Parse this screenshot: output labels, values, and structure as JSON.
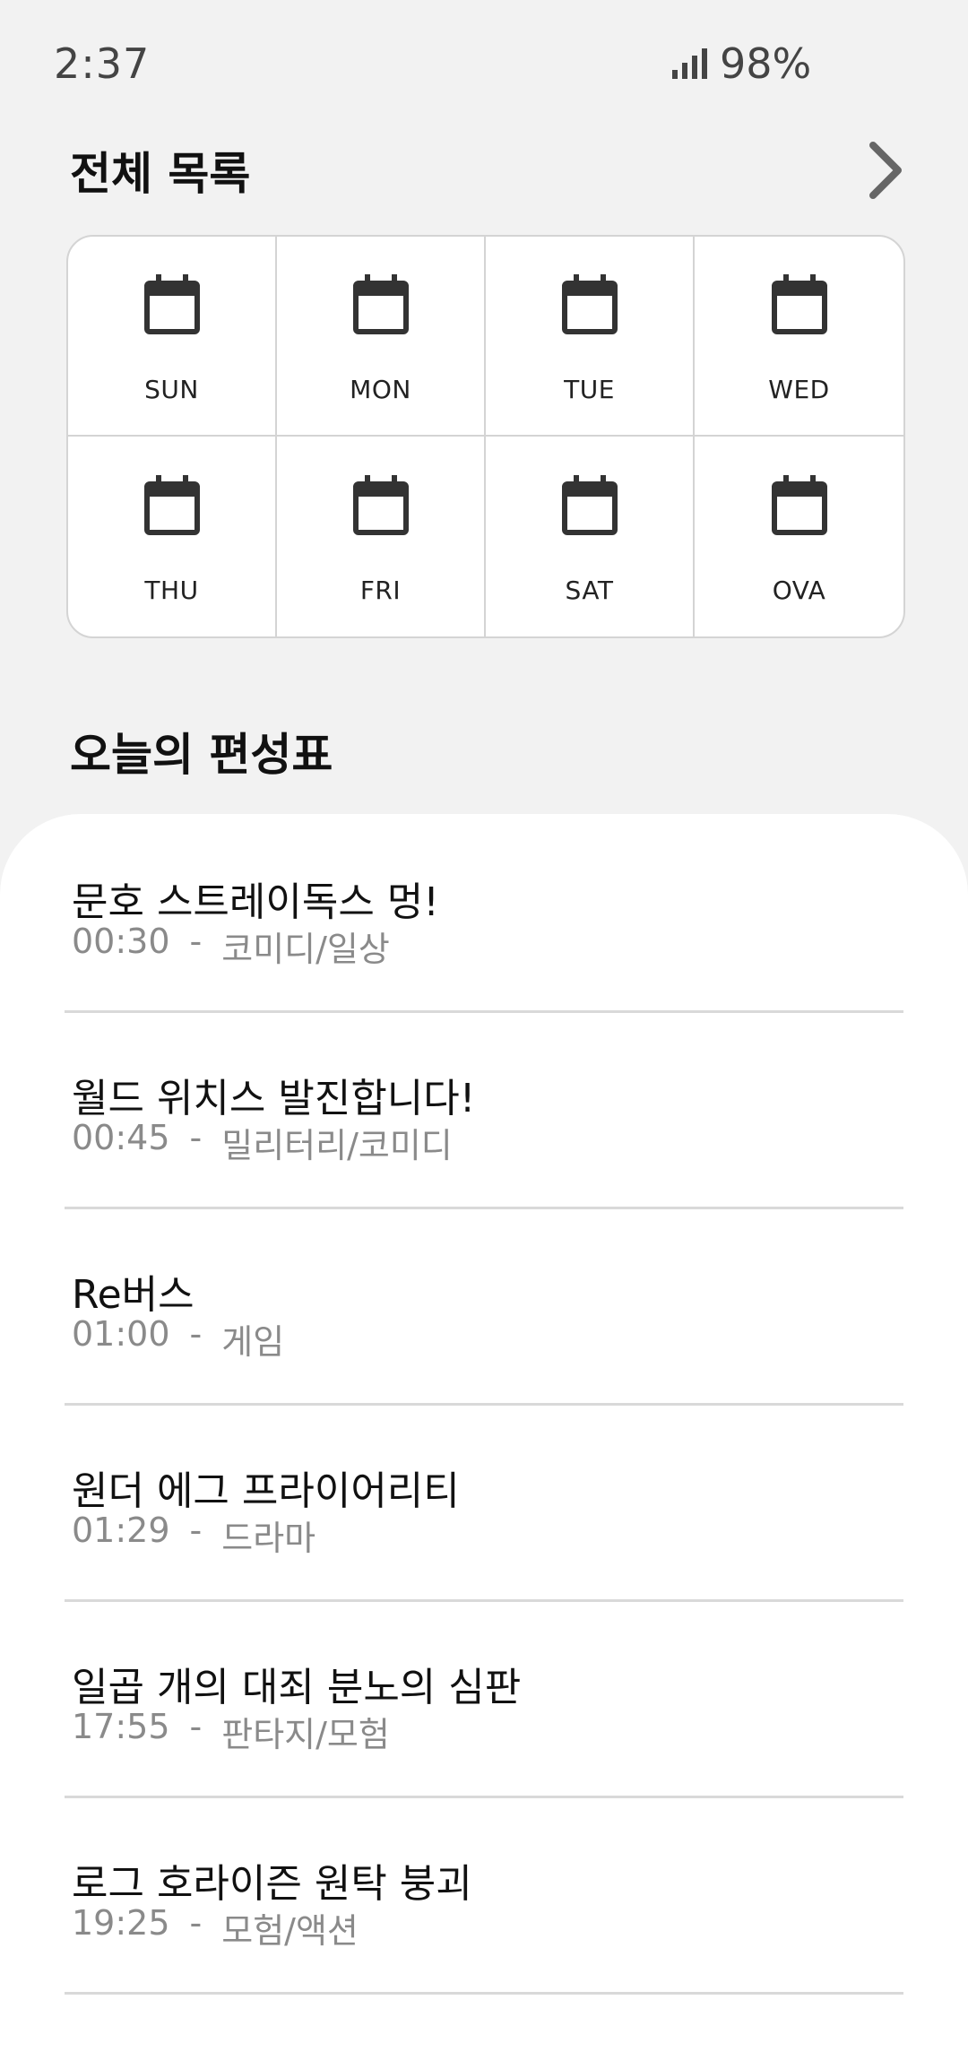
{
  "status_bar": {
    "time": "2:37",
    "battery": "98%",
    "signal_icon": "signal-icon"
  },
  "full_list": {
    "title": "전체 목록",
    "more_icon": "chevron-right-icon"
  },
  "days": [
    {
      "label": "SUN",
      "icon": "calendar-icon"
    },
    {
      "label": "MON",
      "icon": "calendar-icon"
    },
    {
      "label": "TUE",
      "icon": "calendar-icon"
    },
    {
      "label": "WED",
      "icon": "calendar-icon"
    },
    {
      "label": "THU",
      "icon": "calendar-icon"
    },
    {
      "label": "FRI",
      "icon": "calendar-icon"
    },
    {
      "label": "SAT",
      "icon": "calendar-icon"
    },
    {
      "label": "OVA",
      "icon": "calendar-icon"
    }
  ],
  "today": {
    "title": "오늘의 편성표",
    "separator": "-",
    "programs": [
      {
        "title": "문호 스트레이독스 멍!",
        "time": "00:30",
        "genre": "코미디/일상"
      },
      {
        "title": "월드 위치스 발진합니다!",
        "time": "00:45",
        "genre": "밀리터리/코미디"
      },
      {
        "title": "Re버스",
        "time": "01:00",
        "genre": "게임"
      },
      {
        "title": "원더 에그 프라이어리티",
        "time": "01:29",
        "genre": "드라마"
      },
      {
        "title": "일곱 개의 대죄 분노의 심판",
        "time": "17:55",
        "genre": "판타지/모험"
      },
      {
        "title": "로그 호라이즌 원탁 붕괴",
        "time": "19:25",
        "genre": "모험/액션"
      }
    ]
  }
}
